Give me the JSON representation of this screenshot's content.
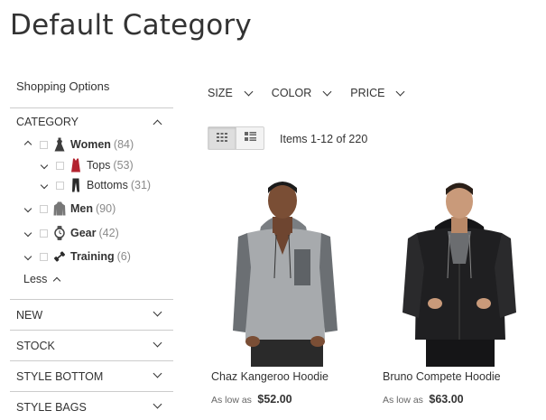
{
  "page": {
    "title": "Default Category"
  },
  "sidebar": {
    "shopping_options": "Shopping Options",
    "category": {
      "title": "CATEGORY",
      "items": [
        {
          "label": "Women",
          "count": "(84)"
        },
        {
          "label": "Tops",
          "count": "(53)"
        },
        {
          "label": "Bottoms",
          "count": "(31)"
        },
        {
          "label": "Men",
          "count": "(90)"
        },
        {
          "label": "Gear",
          "count": "(42)"
        },
        {
          "label": "Training",
          "count": "(6)"
        }
      ],
      "less_label": "Less"
    },
    "filters": [
      {
        "label": "NEW"
      },
      {
        "label": "STOCK"
      },
      {
        "label": "STYLE BOTTOM"
      },
      {
        "label": "STYLE BAGS"
      }
    ]
  },
  "toolbar": {
    "sorters": [
      {
        "label": "SIZE"
      },
      {
        "label": "COLOR"
      },
      {
        "label": "PRICE"
      }
    ],
    "view_modes": [
      "grid-icon",
      "list-icon"
    ],
    "items_amount": "Items 1-12 of 220"
  },
  "products": [
    {
      "name": "Chaz Kangeroo Hoodie",
      "price_prefix": "As low as",
      "price": "$52.00",
      "colors": {
        "body": "#8e9194",
        "sleeve": "#5f6468",
        "skin": "#7a4e35"
      }
    },
    {
      "name": "Bruno Compete Hoodie",
      "price_prefix": "As low as",
      "price": "$63.00",
      "colors": {
        "body": "#1f1f21",
        "sleeve": "#2a2a2c",
        "skin": "#c99a7a"
      }
    }
  ]
}
